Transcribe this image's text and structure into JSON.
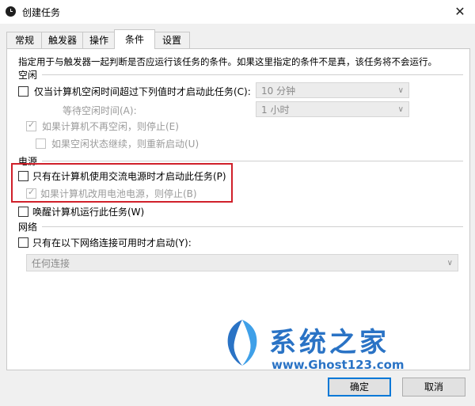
{
  "window": {
    "title": "创建任务",
    "close_glyph": "✕"
  },
  "tabs": [
    {
      "label": "常规",
      "active": false
    },
    {
      "label": "触发器",
      "active": false
    },
    {
      "label": "操作",
      "active": false
    },
    {
      "label": "条件",
      "active": true
    },
    {
      "label": "设置",
      "active": false
    }
  ],
  "description": "指定用于与触发器一起判断是否应运行该任务的条件。如果这里指定的条件不是真，该任务将不会运行。",
  "idle": {
    "section_label": "空闲",
    "start_only_if_idle": {
      "label": "仅当计算机空闲时间超过下列值时才启动此任务(C):",
      "checked": false
    },
    "idle_duration": "10 分钟",
    "wait_label": "等待空闲时间(A):",
    "wait_duration": "1 小时",
    "stop_if_not_idle": {
      "label": "如果计算机不再空闲，则停止(E)",
      "checked": true,
      "enabled": false
    },
    "restart_if_idle_resumes": {
      "label": "如果空闲状态继续，则重新启动(U)",
      "checked": false,
      "enabled": false
    }
  },
  "power": {
    "section_label": "电源",
    "ac_only": {
      "label": "只有在计算机使用交流电源时才启动此任务(P)",
      "checked": false
    },
    "stop_on_battery": {
      "label": "如果计算机改用电池电源，则停止(B)",
      "checked": true,
      "enabled": false
    },
    "wake": {
      "label": "唤醒计算机运行此任务(W)",
      "checked": false
    }
  },
  "network": {
    "section_label": "网络",
    "only_if_network": {
      "label": "只有在以下网络连接可用时才启动(Y):",
      "checked": false
    },
    "connection": "任何连接"
  },
  "buttons": {
    "ok": "确定",
    "cancel": "取消"
  },
  "watermark": {
    "brand": "系统之家",
    "url": "www.Ghost123.com"
  },
  "colors": {
    "highlight_border": "#d0202a",
    "watermark": "#2a73c5",
    "primary_button_border": "#0078d7"
  }
}
